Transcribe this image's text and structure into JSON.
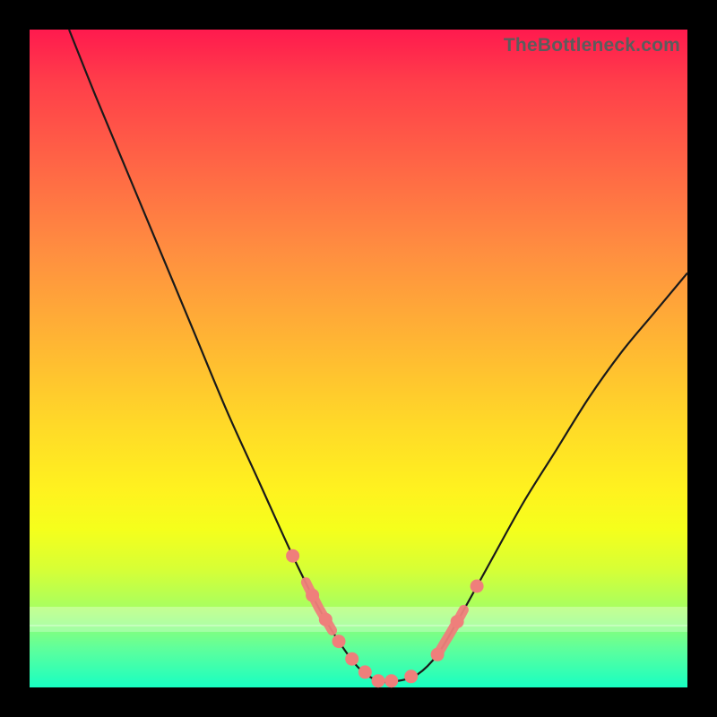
{
  "watermark": "TheBottleneck.com",
  "chart_data": {
    "type": "line",
    "title": "",
    "xlabel": "",
    "ylabel": "",
    "xlim": [
      0,
      100
    ],
    "ylim": [
      0,
      100
    ],
    "grid": false,
    "legend": false,
    "series": [
      {
        "name": "curve",
        "x": [
          6,
          10,
          15,
          20,
          25,
          30,
          35,
          40,
          44,
          47,
          50,
          53,
          56,
          59,
          62,
          65,
          70,
          75,
          80,
          85,
          90,
          95,
          100
        ],
        "y": [
          100,
          90,
          78,
          66,
          54,
          42,
          31,
          20,
          12,
          7,
          3,
          1,
          1,
          2,
          5,
          10,
          19,
          28,
          36,
          44,
          51,
          57,
          63
        ]
      }
    ],
    "highlighted_points_x": [
      40,
      43,
      45,
      47,
      49,
      51,
      53,
      55,
      58,
      62,
      65,
      68
    ],
    "highlighted_segments": [
      {
        "x0": 42,
        "x1": 46
      },
      {
        "x0": 62,
        "x1": 66
      }
    ],
    "marker_color": "#ef7f7b",
    "curve_color": "#1a1a1a"
  }
}
